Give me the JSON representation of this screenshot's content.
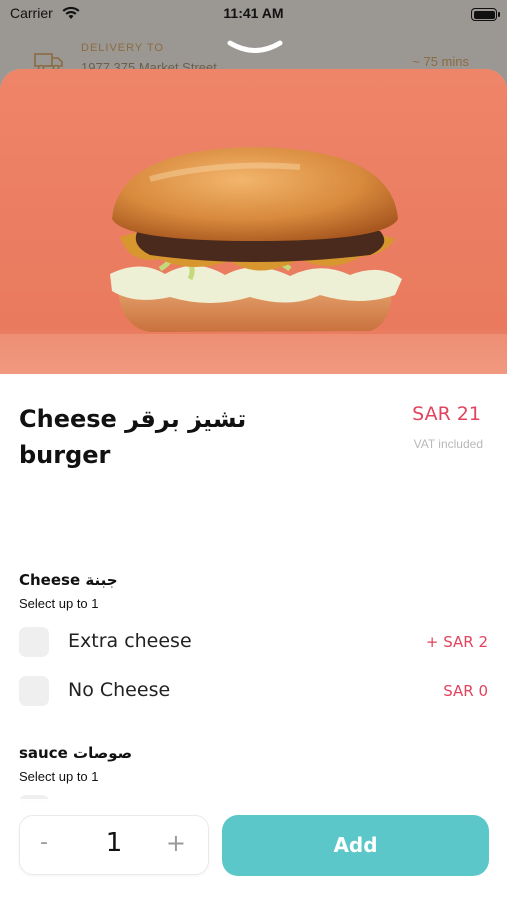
{
  "status_bar": {
    "carrier": "Carrier",
    "time": "11:41 AM"
  },
  "background": {
    "delivery_label": "DELIVERY TO",
    "address": "1977 375 Market Street",
    "eta": "~ 75 mins"
  },
  "product": {
    "title_line1": "Cheese تشيز برقر",
    "title_line2": "burger",
    "price": "SAR 21",
    "vat_note": "VAT included",
    "hero_background": "#ec8065"
  },
  "groups": [
    {
      "title": "Cheese جبنة",
      "subtitle": "Select up to 1",
      "options": [
        {
          "name": "Extra cheese",
          "price": "+  SAR 2"
        },
        {
          "name": "No Cheese",
          "price": "SAR 0"
        }
      ]
    },
    {
      "title": "sauce صوصات",
      "subtitle": "Select up to 1",
      "options": []
    }
  ],
  "footer": {
    "minus": "-",
    "quantity": "1",
    "plus": "+",
    "add_label": "Add"
  },
  "colors": {
    "accent_red": "#e2435e",
    "add_button": "#5bc7c8"
  }
}
